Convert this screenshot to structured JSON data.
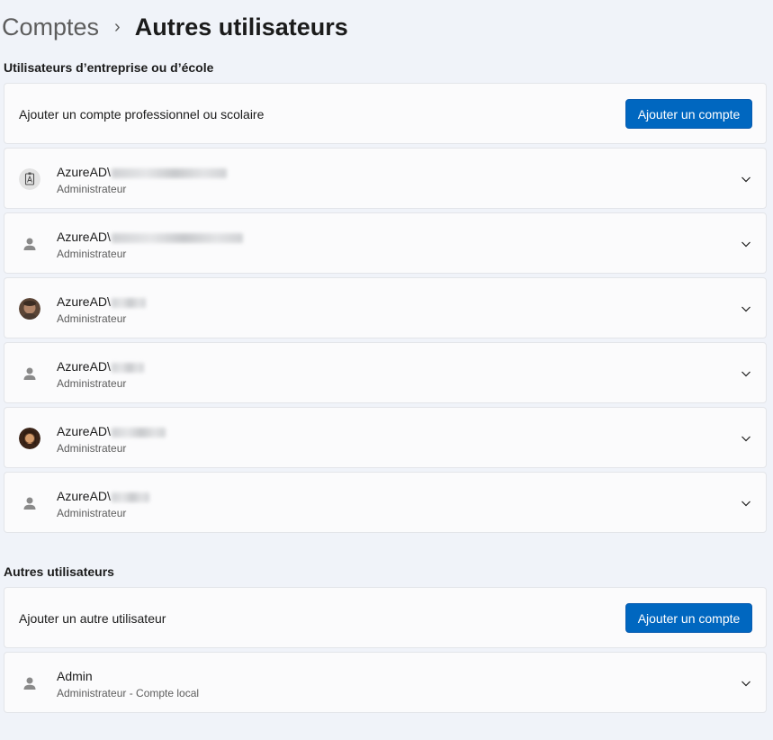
{
  "breadcrumb": {
    "parent": "Comptes",
    "separator": "›",
    "current": "Autres utilisateurs"
  },
  "work_section": {
    "title": "Utilisateurs d’entreprise ou d’école",
    "add_label": "Ajouter un compte professionnel ou scolaire",
    "add_button": "Ajouter un compte",
    "users": [
      {
        "prefix": "AzureAD\\",
        "role": "Administrateur",
        "avatar": "badge-icon"
      },
      {
        "prefix": "AzureAD\\",
        "role": "Administrateur",
        "avatar": "person-icon"
      },
      {
        "prefix": "AzureAD\\",
        "role": "Administrateur",
        "avatar": "photo"
      },
      {
        "prefix": "AzureAD\\",
        "role": "Administrateur",
        "avatar": "person-icon"
      },
      {
        "prefix": "AzureAD\\",
        "role": "Administrateur",
        "avatar": "photo"
      },
      {
        "prefix": "AzureAD\\",
        "role": "Administrateur",
        "avatar": "person-icon"
      }
    ]
  },
  "other_section": {
    "title": "Autres utilisateurs",
    "add_label": "Ajouter un autre utilisateur",
    "add_button": "Ajouter un compte",
    "users": [
      {
        "name": "Admin",
        "role": "Administrateur - Compte local",
        "avatar": "person-icon"
      }
    ]
  },
  "colors": {
    "accent": "#0067c0",
    "background": "#f0f3f9",
    "card": "#fbfbfc"
  }
}
